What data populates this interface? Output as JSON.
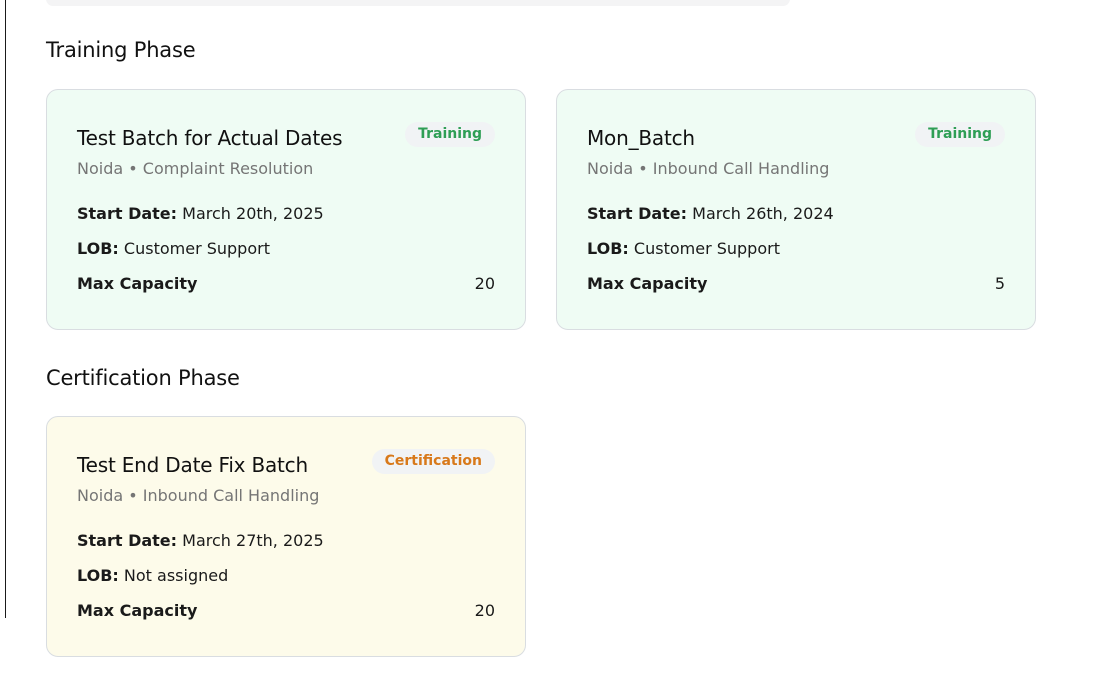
{
  "sections": {
    "training": {
      "title": "Training Phase",
      "batches": [
        {
          "name": "Test Batch for Actual Dates",
          "location_line": "Noida • Complaint Resolution",
          "status": "Training",
          "start_date_label": "Start Date:",
          "start_date": "March 20th, 2025",
          "lob_label": "LOB:",
          "lob": "Customer Support",
          "capacity_label": "Max Capacity",
          "capacity": "20"
        },
        {
          "name": "Mon_Batch",
          "location_line": "Noida • Inbound Call Handling",
          "status": "Training",
          "start_date_label": "Start Date:",
          "start_date": "March 26th, 2024",
          "lob_label": "LOB:",
          "lob": "Customer Support",
          "capacity_label": "Max Capacity",
          "capacity": "5"
        }
      ]
    },
    "certification": {
      "title": "Certification Phase",
      "batches": [
        {
          "name": "Test End Date Fix Batch",
          "location_line": "Noida • Inbound Call Handling",
          "status": "Certification",
          "start_date_label": "Start Date:",
          "start_date": "March 27th, 2025",
          "lob_label": "LOB:",
          "lob": "Not assigned",
          "capacity_label": "Max Capacity",
          "capacity": "20"
        }
      ]
    }
  },
  "colors": {
    "training_card_bg": "#effcf4",
    "certification_card_bg": "#fdfbea",
    "training_badge_text": "#2e9e55",
    "certification_badge_text": "#d8791a",
    "badge_bg": "#f1f3f5"
  }
}
